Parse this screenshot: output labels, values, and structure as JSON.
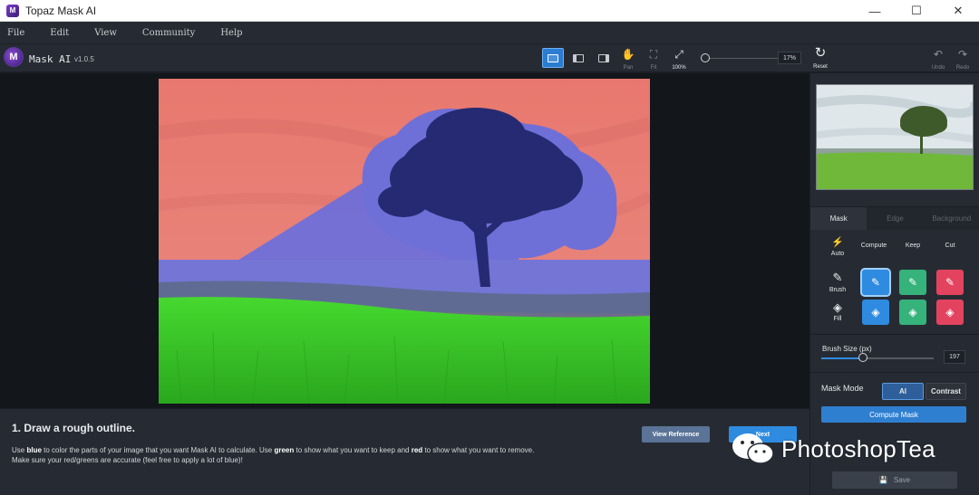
{
  "window": {
    "title": "Topaz Mask AI",
    "minimize": "—",
    "maximize": "☐",
    "close": "✕"
  },
  "menu": {
    "items": [
      "File",
      "Edit",
      "View",
      "Community",
      "Help"
    ]
  },
  "brand": {
    "name": "Mask AI",
    "version": "v1.0.5"
  },
  "toolbar": {
    "pan_label": "Pan",
    "fit_label": "Fit",
    "zoom100_label": "100%",
    "zoom_value": "17%",
    "reset_label": "Reset",
    "undo_label": "Undo",
    "redo_label": "Redo"
  },
  "panel": {
    "tabs": [
      "Mask",
      "Edge",
      "Background"
    ],
    "auto_label": "Auto",
    "columns": [
      "Compute",
      "Keep",
      "Cut"
    ],
    "brush_label": "Brush",
    "fill_label": "Fill",
    "brush_size_label": "Brush Size (px)",
    "brush_size_value": "197",
    "brush_size_level": 0.37,
    "mask_mode_label": "Mask Mode",
    "mode_ai": "AI",
    "mode_contrast": "Contrast",
    "compute_mask": "Compute Mask",
    "save": "Save"
  },
  "instructions": {
    "title": "1. Draw a rough outline.",
    "t1": "Use ",
    "blue": "blue",
    "t2": " to color the parts of your image that you want Mask AI to calculate. Use ",
    "green": "green",
    "t3": " to show what you want to keep and ",
    "red": "red",
    "t4": " to show what you want to remove.",
    "t5": "Make sure your red/greens are accurate (feel free to apply a lot of blue)!",
    "view_reference": "View Reference",
    "next": "Next"
  },
  "watermark": {
    "text": "PhotoshopTea"
  },
  "colors": {
    "accent": "#2f8be0",
    "compute": "#2f8be0",
    "keep": "#36b27b",
    "cut": "#e3435f",
    "mask_red": "#e37a72",
    "mask_blue": "#6f6fd8",
    "mask_green": "#3fcf2a"
  }
}
